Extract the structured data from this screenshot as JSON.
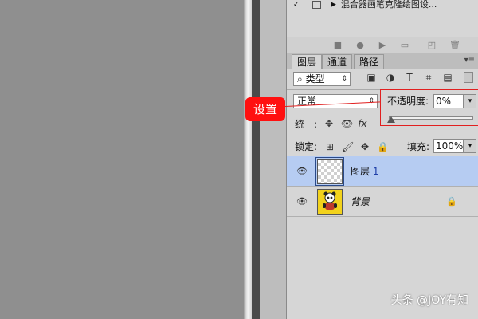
{
  "history": {
    "item_label": "混合器画笔克隆绘图设...",
    "toolbar_icons": [
      "stop-icon",
      "record-icon",
      "play-icon",
      "folder-icon",
      "new-icon",
      "delete-icon"
    ]
  },
  "tabs": [
    {
      "label": "图层",
      "active": true
    },
    {
      "label": "通道",
      "active": false
    },
    {
      "label": "路径",
      "active": false
    }
  ],
  "filter": {
    "label": "类型",
    "search_glyph": "⌕"
  },
  "blend_mode": "正常",
  "opacity": {
    "label": "不透明度:",
    "value": "0%",
    "value_percent": 0
  },
  "unify": {
    "label": "统一:",
    "fx": "fx"
  },
  "lock": {
    "label": "锁定:"
  },
  "fill": {
    "label": "填充:",
    "value": "100%"
  },
  "layers": [
    {
      "name": "图层",
      "number": "1",
      "selected": true
    },
    {
      "name": "背景",
      "selected": false,
      "locked": true
    }
  ],
  "callout": {
    "text": "设置"
  },
  "watermark": "头条 @JOY有知",
  "colors": {
    "selection": "#b6ccf2",
    "callout": "#ff1010",
    "annotation_red": "#e12020"
  }
}
